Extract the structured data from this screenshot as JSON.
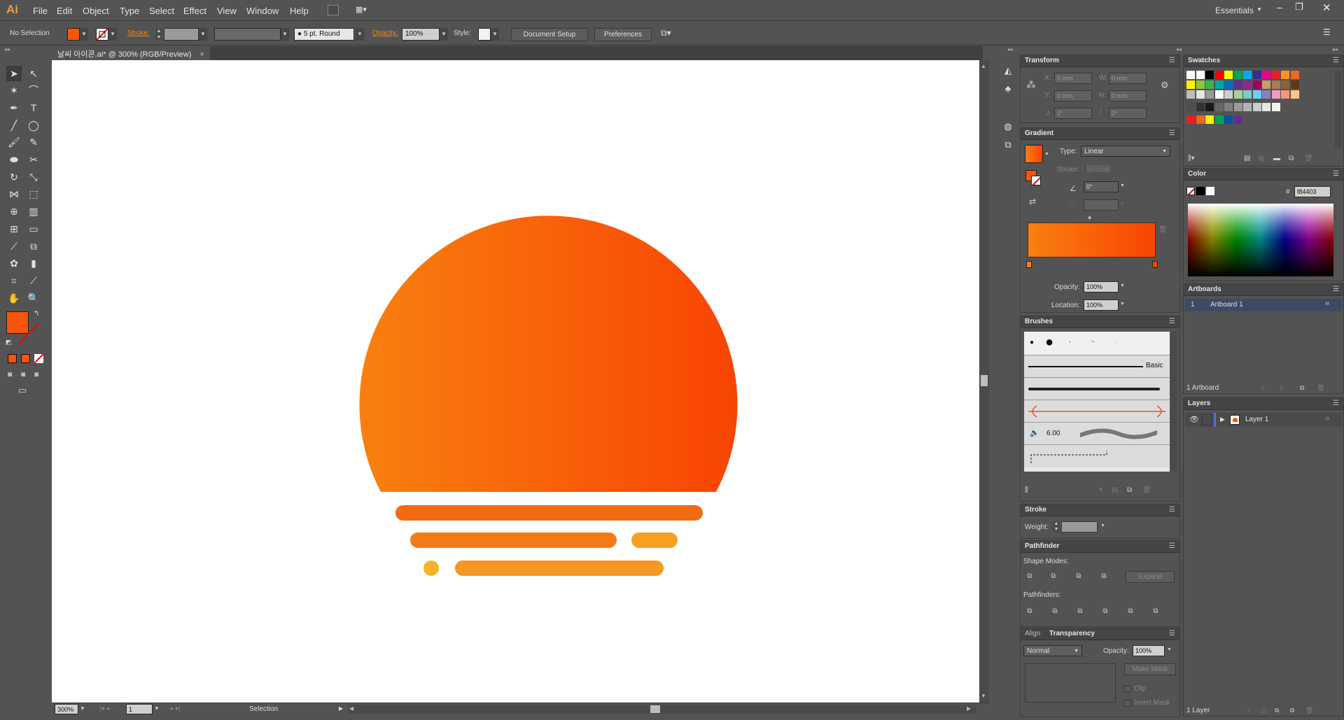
{
  "app": {
    "logo": "Ai",
    "workspace": "Essentials"
  },
  "menu": [
    "File",
    "Edit",
    "Object",
    "Type",
    "Select",
    "Effect",
    "View",
    "Window",
    "Help"
  ],
  "control_bar": {
    "selection": "No Selection",
    "stroke_label": "Stroke:",
    "brush": "5 pt. Round",
    "opacity_label": "Opacity:",
    "opacity": "100%",
    "style_label": "Style:",
    "document_setup": "Document Setup",
    "preferences": "Preferences"
  },
  "document": {
    "tab": "날씨 아이콘.ai* @ 300% (RGB/Preview)"
  },
  "artwork": {
    "sun_gradient": [
      "#f8800f",
      "#f84403"
    ],
    "bar_colors": [
      "#f26a11",
      "#f47a18",
      "#f5a021",
      "#f5b327",
      "#f59722"
    ]
  },
  "status": {
    "zoom": "300%",
    "page": "1",
    "tool": "Selection"
  },
  "transform": {
    "title": "Transform",
    "x_label": "X:",
    "x": "0 mm",
    "y_label": "Y:",
    "y": "0 mm",
    "w_label": "W:",
    "w": "0 mm",
    "h_label": "H:",
    "h": "0 mm",
    "angle": "0°",
    "shear": "0°"
  },
  "gradient": {
    "title": "Gradient",
    "type_label": "Type:",
    "type": "Linear",
    "stroke_label": "Stroke:",
    "angle": "0°",
    "opacity_label": "Opacity:",
    "opacity": "100%",
    "location_label": "Location:",
    "location": "100%",
    "colors": [
      "#f8800f",
      "#f84403"
    ]
  },
  "brushes": {
    "title": "Brushes",
    "basic": "Basic",
    "size": "6.00"
  },
  "stroke": {
    "title": "Stroke",
    "weight_label": "Weight:"
  },
  "pathfinder": {
    "title": "Pathfinder",
    "shape_modes": "Shape Modes:",
    "pathfinders": "Pathfinders:",
    "expand": "Expand"
  },
  "transparency": {
    "align_tab": "Align",
    "title": "Transparency",
    "blend": "Normal",
    "opacity_label": "Opacity:",
    "opacity": "100%",
    "make_mask": "Make Mask",
    "clip": "Clip",
    "invert_mask": "Invert Mask"
  },
  "swatches": {
    "title": "Swatches"
  },
  "color": {
    "title": "Color",
    "hash": "#",
    "hex": "f84403"
  },
  "artboards": {
    "title": "Artboards",
    "index": "1",
    "name": "Artboard 1",
    "count": "1 Artboard"
  },
  "layers": {
    "title": "Layers",
    "name": "Layer 1",
    "count": "1 Layer"
  }
}
